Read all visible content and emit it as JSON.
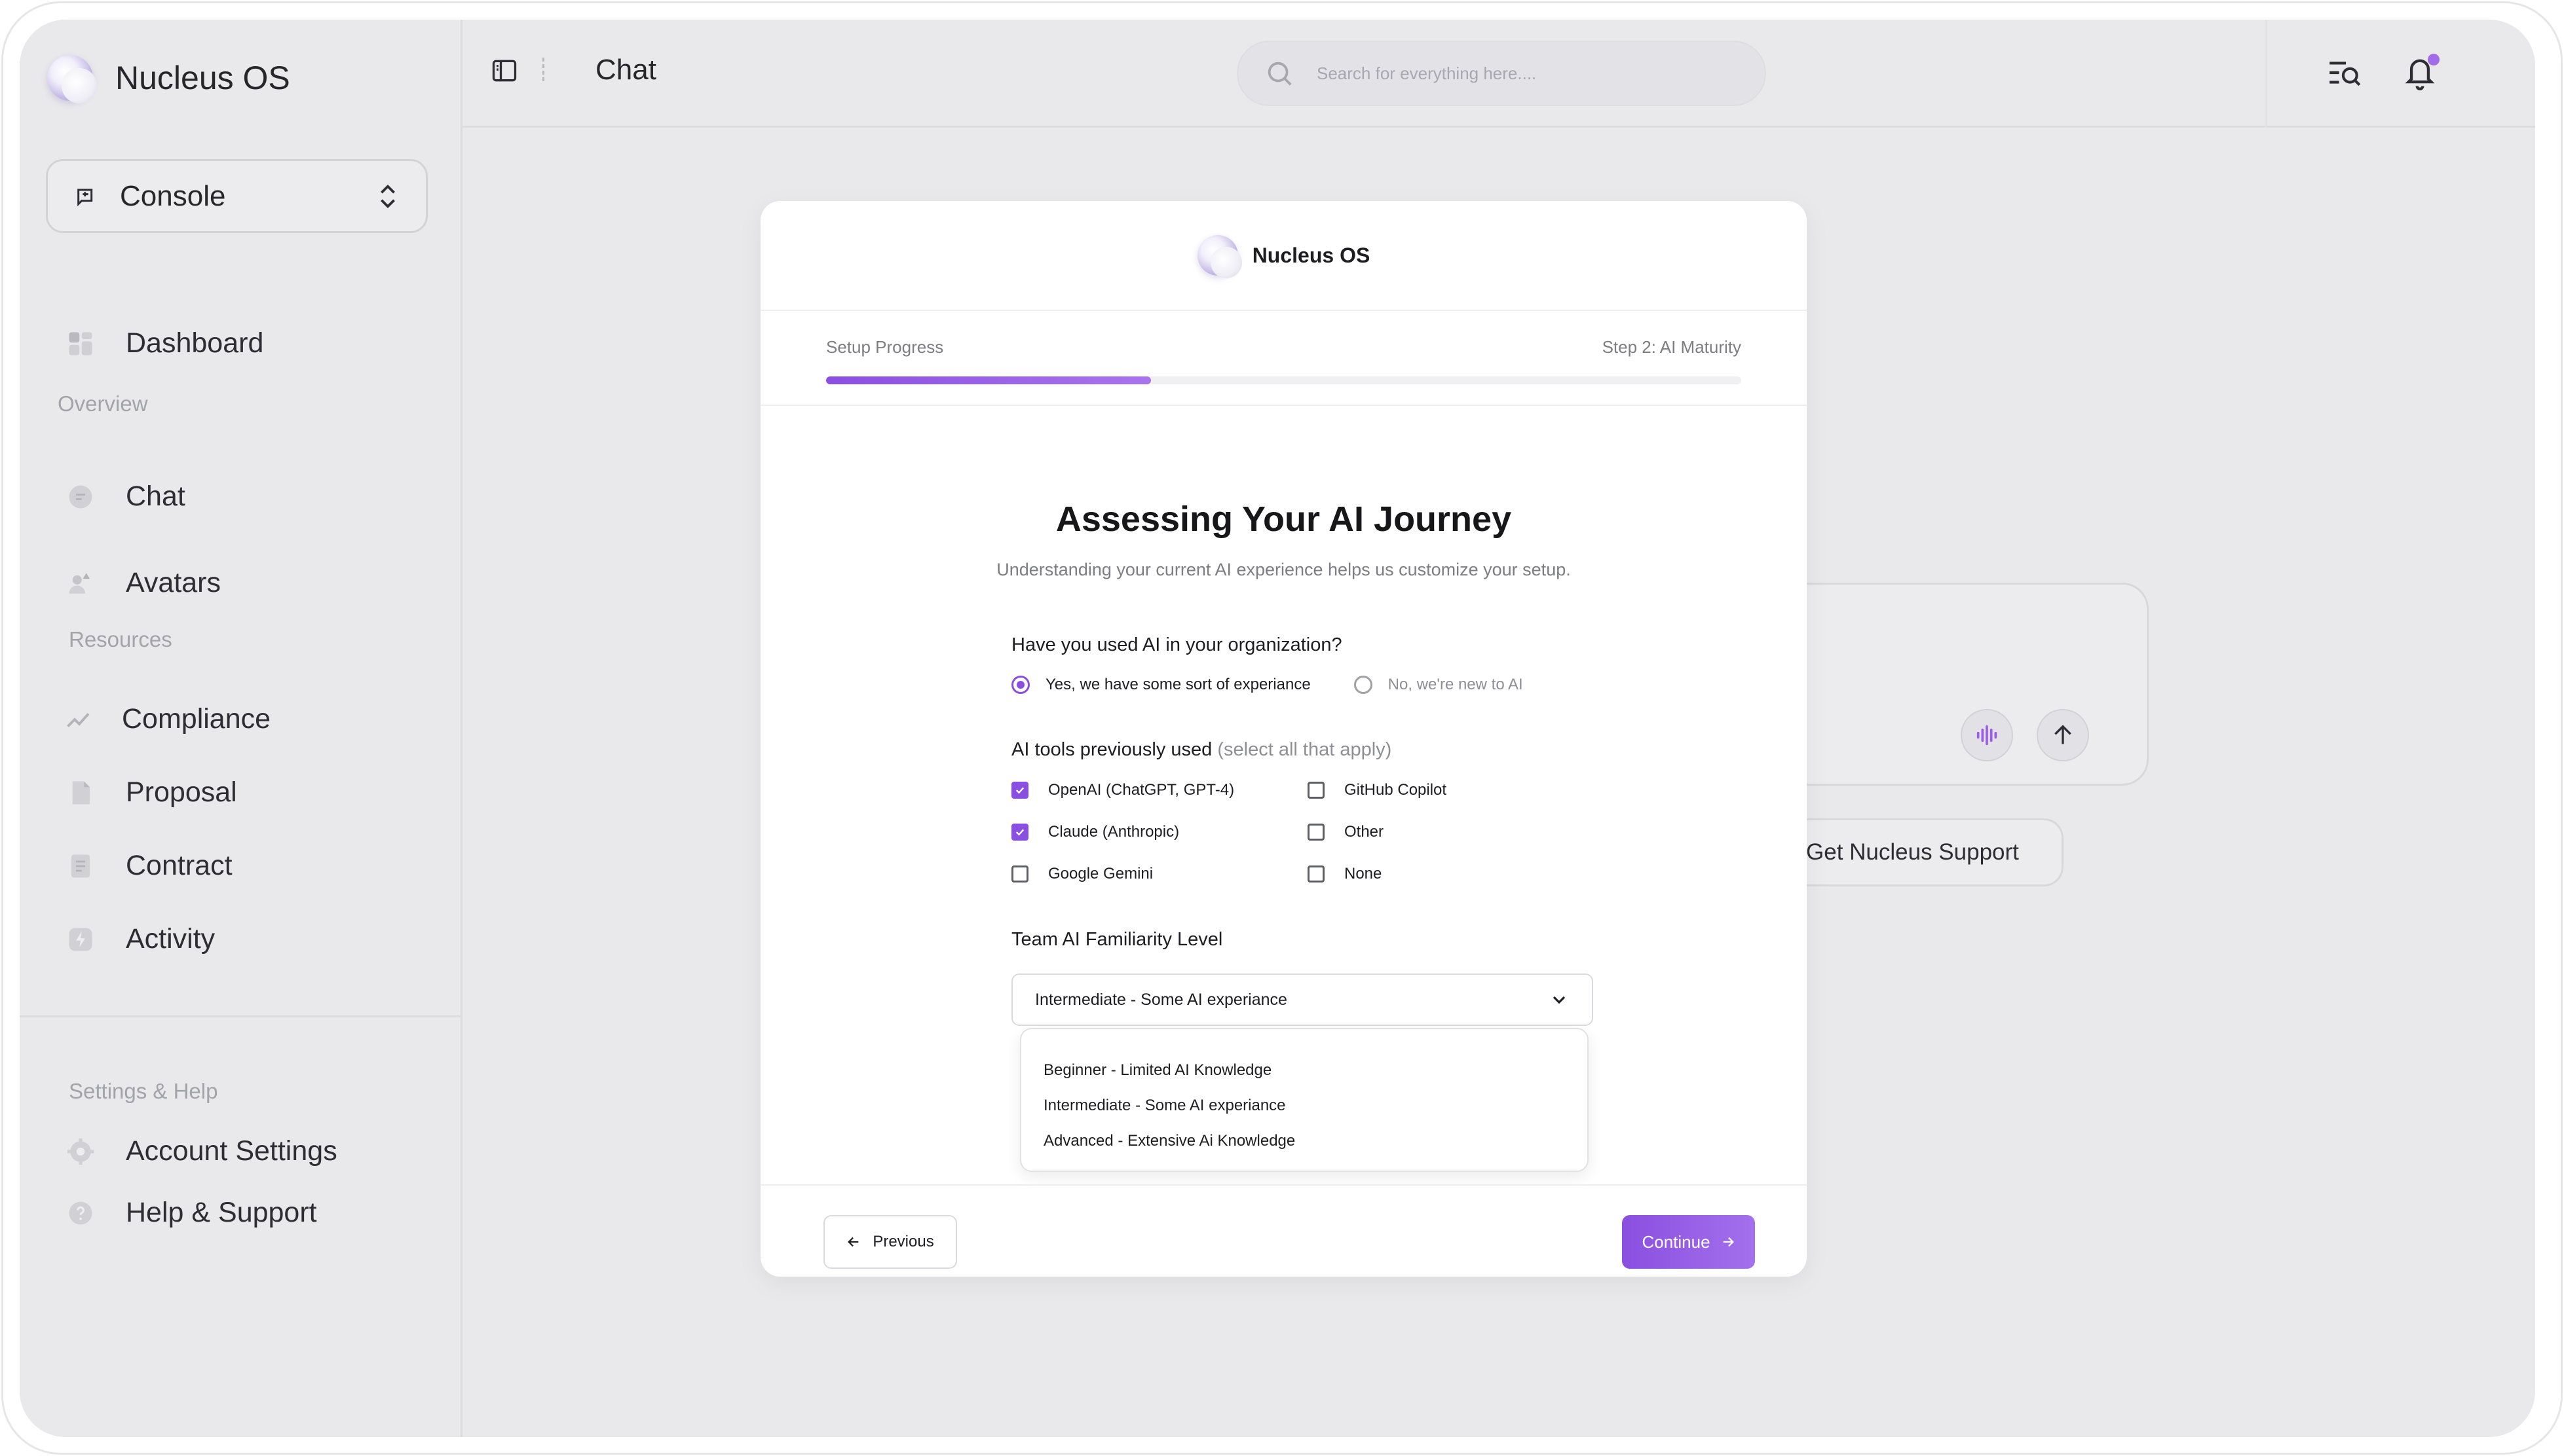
{
  "app": {
    "name": "Nucleus OS"
  },
  "sidebar": {
    "console_label": "Console",
    "dashboard": "Dashboard",
    "overview_label": "Overview",
    "chat": "Chat",
    "avatars": "Avatars",
    "resources_label": "Resources",
    "compliance": "Compliance",
    "proposal": "Proposal",
    "contract": "Contract",
    "activity": "Activity",
    "settings_label": "Settings & Help",
    "account_settings": "Account Settings",
    "help_support": "Help & Support"
  },
  "topbar": {
    "title": "Chat",
    "search_placeholder": "Search for everything here....",
    "notification_dot_color": "#a26be8"
  },
  "background": {
    "support_button": "Get Nucleus Support"
  },
  "modal": {
    "brand": "Nucleus OS",
    "progress": {
      "label": "Setup Progress",
      "step": "Step 2: AI Maturity",
      "percent": 35.5
    },
    "title": "Assessing Your AI Journey",
    "subtitle": "Understanding your current AI experience helps us customize your setup.",
    "q1": {
      "label": "Have you used AI in your organization?",
      "options": [
        {
          "label": "Yes, we have some sort of experiance",
          "selected": true
        },
        {
          "label": "No, we're new to AI",
          "selected": false
        }
      ]
    },
    "q2": {
      "label": "AI tools previously used",
      "hint": "(select all that apply)",
      "options": [
        {
          "label": "OpenAI (ChatGPT, GPT-4)",
          "checked": true
        },
        {
          "label": "Claude (Anthropic)",
          "checked": true
        },
        {
          "label": "Google Gemini",
          "checked": false
        },
        {
          "label": "GitHub Copilot",
          "checked": false
        },
        {
          "label": "Other",
          "checked": false
        },
        {
          "label": "None",
          "checked": false
        }
      ]
    },
    "q3": {
      "label": "Team AI Familiarity Level",
      "selected": "Intermediate - Some AI experiance",
      "options": [
        "Beginner - Limited AI Knowledge",
        "Intermediate - Some AI experiance",
        "Advanced - Extensive Ai Knowledge"
      ]
    },
    "footer": {
      "previous": "Previous",
      "continue": "Continue"
    },
    "accent_color": "#8a4fe0"
  }
}
